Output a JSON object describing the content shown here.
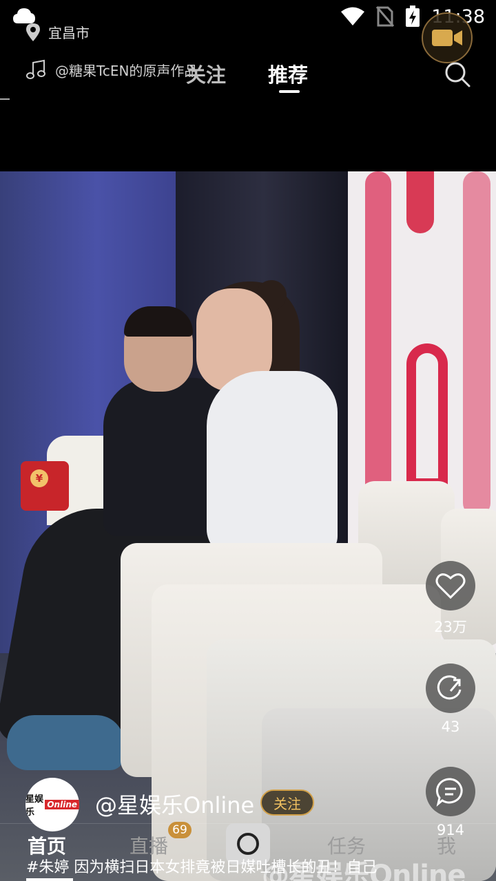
{
  "status_bar": {
    "time": "11:38",
    "icons": [
      "cloud-icon",
      "wifi-icon",
      "no-sim-icon",
      "battery-charging-icon"
    ]
  },
  "top_bar": {
    "location": "宜昌市",
    "music": "@糖果TcEN的原声作品",
    "tabs": [
      {
        "label": "关注",
        "active": false
      },
      {
        "label": "推荐",
        "active": true
      }
    ]
  },
  "video": {
    "watermark": "@星娱乐Online"
  },
  "actions": {
    "likes": "23万",
    "shares": "43",
    "comments": "914"
  },
  "author": {
    "name": "@星娱乐Online",
    "follow_label": "关注",
    "avatar_text": "星娱乐",
    "avatar_tag": "Online"
  },
  "caption": "#朱婷 因为横扫日本女排竟被日媒吐槽长的丑！自己",
  "nav": {
    "home": "首页",
    "live": "直播",
    "live_badge": "69",
    "task": "任务",
    "me": "我"
  },
  "colors": {
    "accent_gold": "#d2a14a",
    "red_packet": "#c8252a"
  }
}
